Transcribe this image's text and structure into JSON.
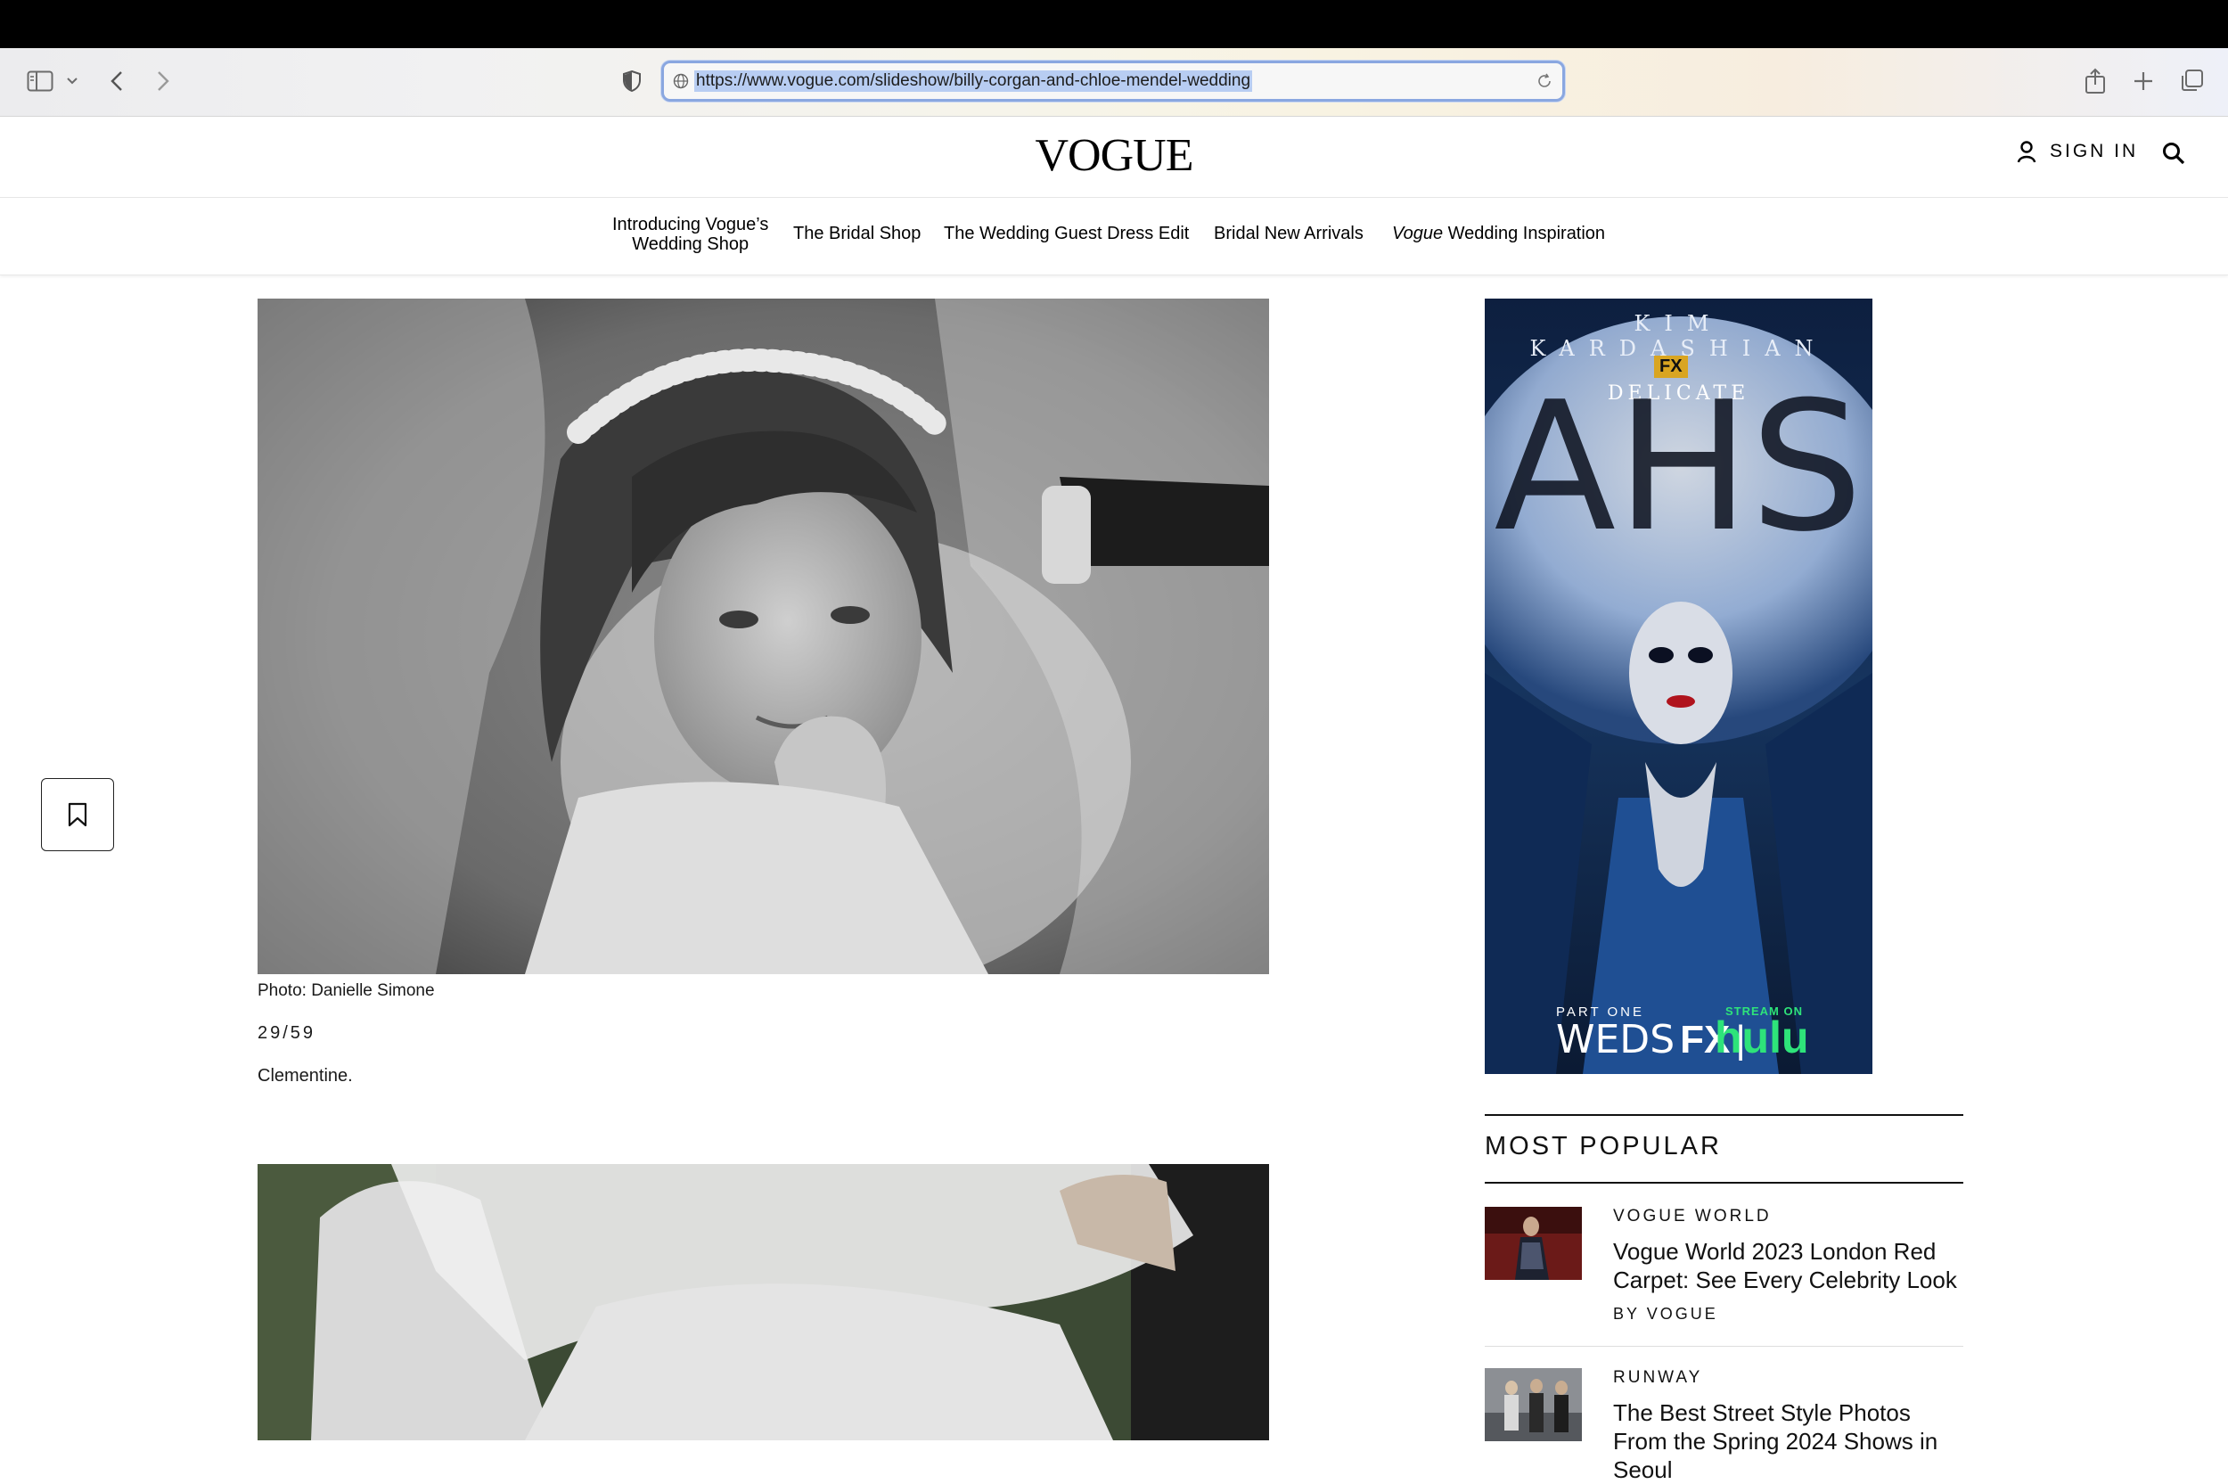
{
  "browser": {
    "url": "https://www.vogue.com/slideshow/billy-corgan-and-chloe-mendel-wedding"
  },
  "site": {
    "logo": "VOGUE",
    "sign_in": "SIGN IN"
  },
  "nav": {
    "items": [
      {
        "line1": "Introducing Vogue’s",
        "line2": "Wedding Shop"
      },
      {
        "label": "The Bridal Shop"
      },
      {
        "label": "The Wedding Guest Dress Edit"
      },
      {
        "label": "Bridal New Arrivals"
      },
      {
        "italic": "Vogue",
        "label": " Wedding Inspiration"
      }
    ]
  },
  "slide": {
    "credit": "Photo: Danielle Simone",
    "counter": "29/59",
    "caption": "Clementine."
  },
  "ad": {
    "top_text": "KIM KARDASHIAN",
    "network_badge": "FX",
    "subtitle": "DELICATE",
    "show_logo": "AHS",
    "part": "PART ONE",
    "day": "WEDS",
    "network": "FX",
    "stream_label": "STREAM ON",
    "stream_service": "hulu"
  },
  "most_popular": {
    "title": "MOST POPULAR",
    "items": [
      {
        "category": "VOGUE WORLD",
        "headline": "Vogue World 2023 London Red Carpet: See Every Celebrity Look",
        "byline": "BY VOGUE"
      },
      {
        "category": "RUNWAY",
        "headline": "The Best Street Style Photos From the Spring 2024 Shows in Seoul",
        "byline": ""
      }
    ]
  },
  "colors": {
    "url_highlight": "#b8cdf2",
    "url_focus_ring": "#8aa7e0",
    "ad_blue": "#1b4a8c",
    "hulu_green": "#2ee37a"
  }
}
